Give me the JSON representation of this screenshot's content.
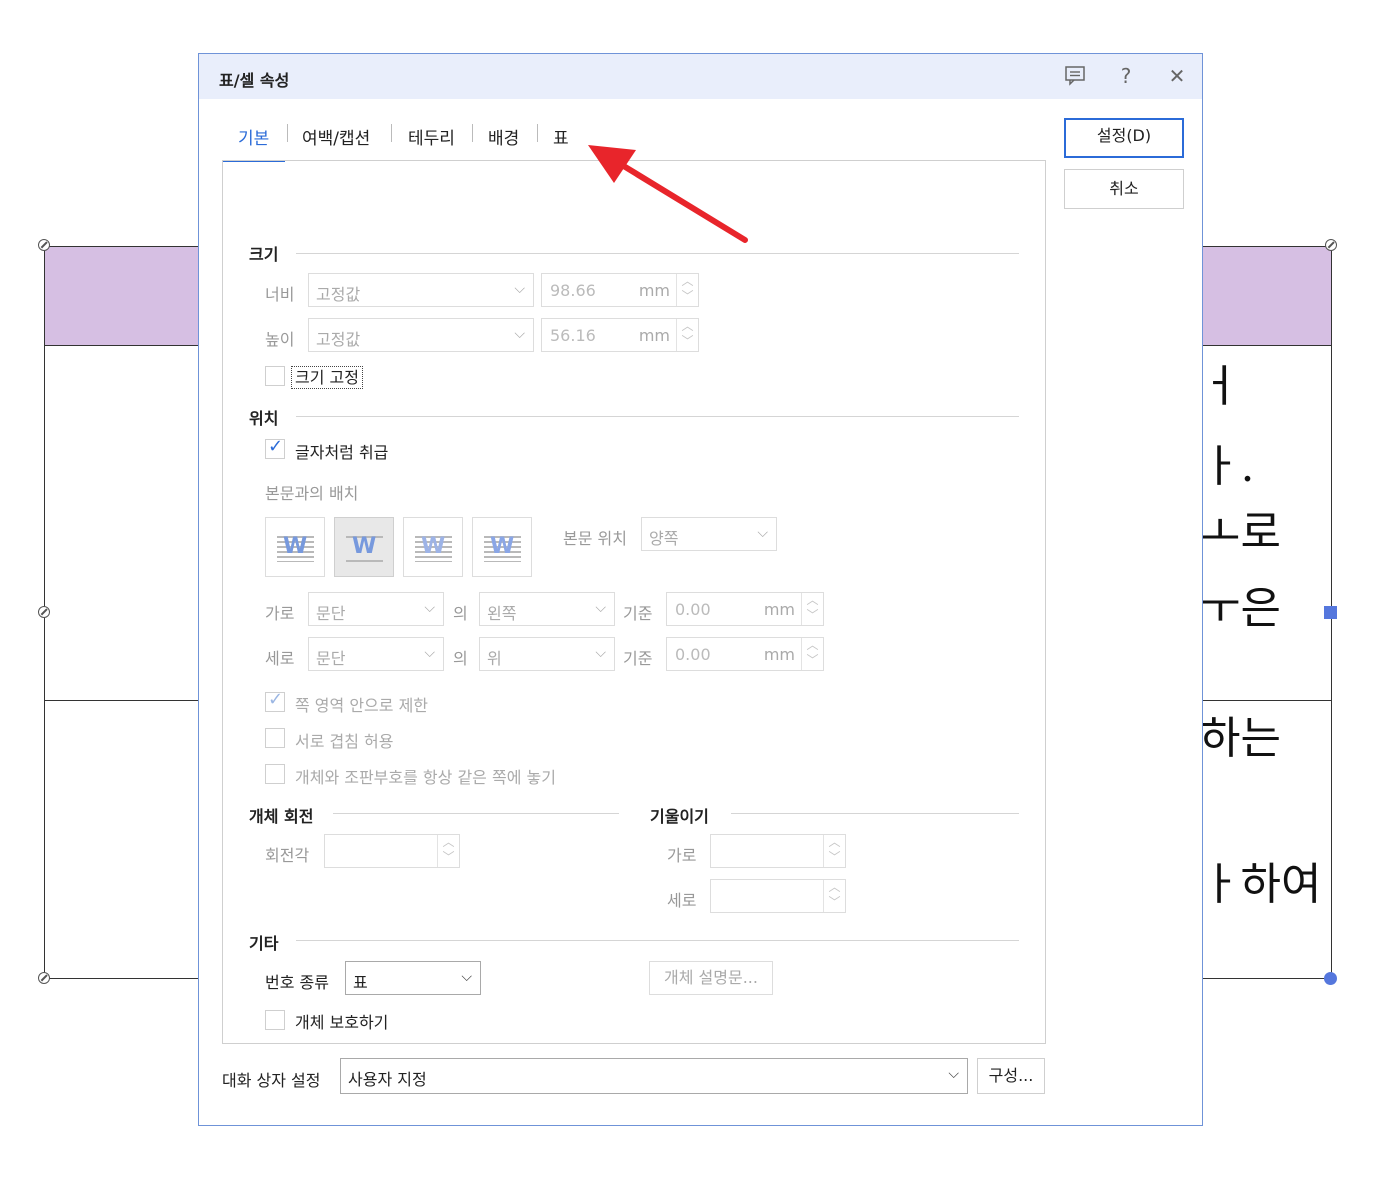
{
  "background": {
    "lines": [
      "ㅓ",
      "ㅏ.",
      "ㅗ로",
      "ㅜ은",
      "하는",
      "ㅏ하여"
    ]
  },
  "dialog": {
    "title": "표/셀 속성",
    "titlebar_icons": [
      "comment-icon",
      "help-icon",
      "close-icon"
    ],
    "help_glyph": "?",
    "close_glyph": "✕",
    "tabs": [
      {
        "label": "기본",
        "active": true
      },
      {
        "label": "여백/캡션",
        "active": false
      },
      {
        "label": "테두리",
        "active": false
      },
      {
        "label": "배경",
        "active": false
      },
      {
        "label": "표",
        "active": false
      }
    ],
    "buttons": {
      "ok": "설정(D)",
      "cancel": "취소"
    },
    "size": {
      "section": "크기",
      "width_label": "너비",
      "width_mode": "고정값",
      "width_value": "98.66",
      "height_label": "높이",
      "height_mode": "고정값",
      "height_value": "56.16",
      "unit": "mm",
      "lock_label": "크기 고정"
    },
    "position": {
      "section": "위치",
      "treat_as_char_label": "글자처럼 취급",
      "body_arrange_label": "본문과의 배치",
      "body_position_label": "본문 위치",
      "body_position_value": "양쪽",
      "horizontal_label": "가로",
      "horizontal_ref": "문단",
      "of_label": "의",
      "horizontal_align": "왼쪽",
      "base_label": "기준",
      "horizontal_offset": "0.00",
      "vertical_label": "세로",
      "vertical_ref": "문단",
      "vertical_align": "위",
      "vertical_offset": "0.00",
      "unit": "mm",
      "limit_page_label": "쪽 영역 안으로 제한",
      "allow_overlap_label": "서로 겹침 허용",
      "same_page_label": "개체와 조판부호를 항상 같은 쪽에 놓기"
    },
    "rotation": {
      "section": "개체 회전",
      "angle_label": "회전각"
    },
    "skew": {
      "section": "기울이기",
      "horizontal_label": "가로",
      "vertical_label": "세로"
    },
    "misc": {
      "section": "기타",
      "number_type_label": "번호 종류",
      "number_type_value": "표",
      "description_button": "개체 설명문...",
      "protect_label": "개체 보호하기"
    },
    "footer": {
      "settings_label": "대화 상자 설정",
      "settings_value": "사용자 지정",
      "configure_button": "구성..."
    }
  },
  "annotation": {
    "arrow_color": "#e8252b"
  },
  "colors": {
    "accent": "#2b6bd8",
    "header_fill": "#d6bfe3",
    "dialog_border": "#6f93d8"
  }
}
